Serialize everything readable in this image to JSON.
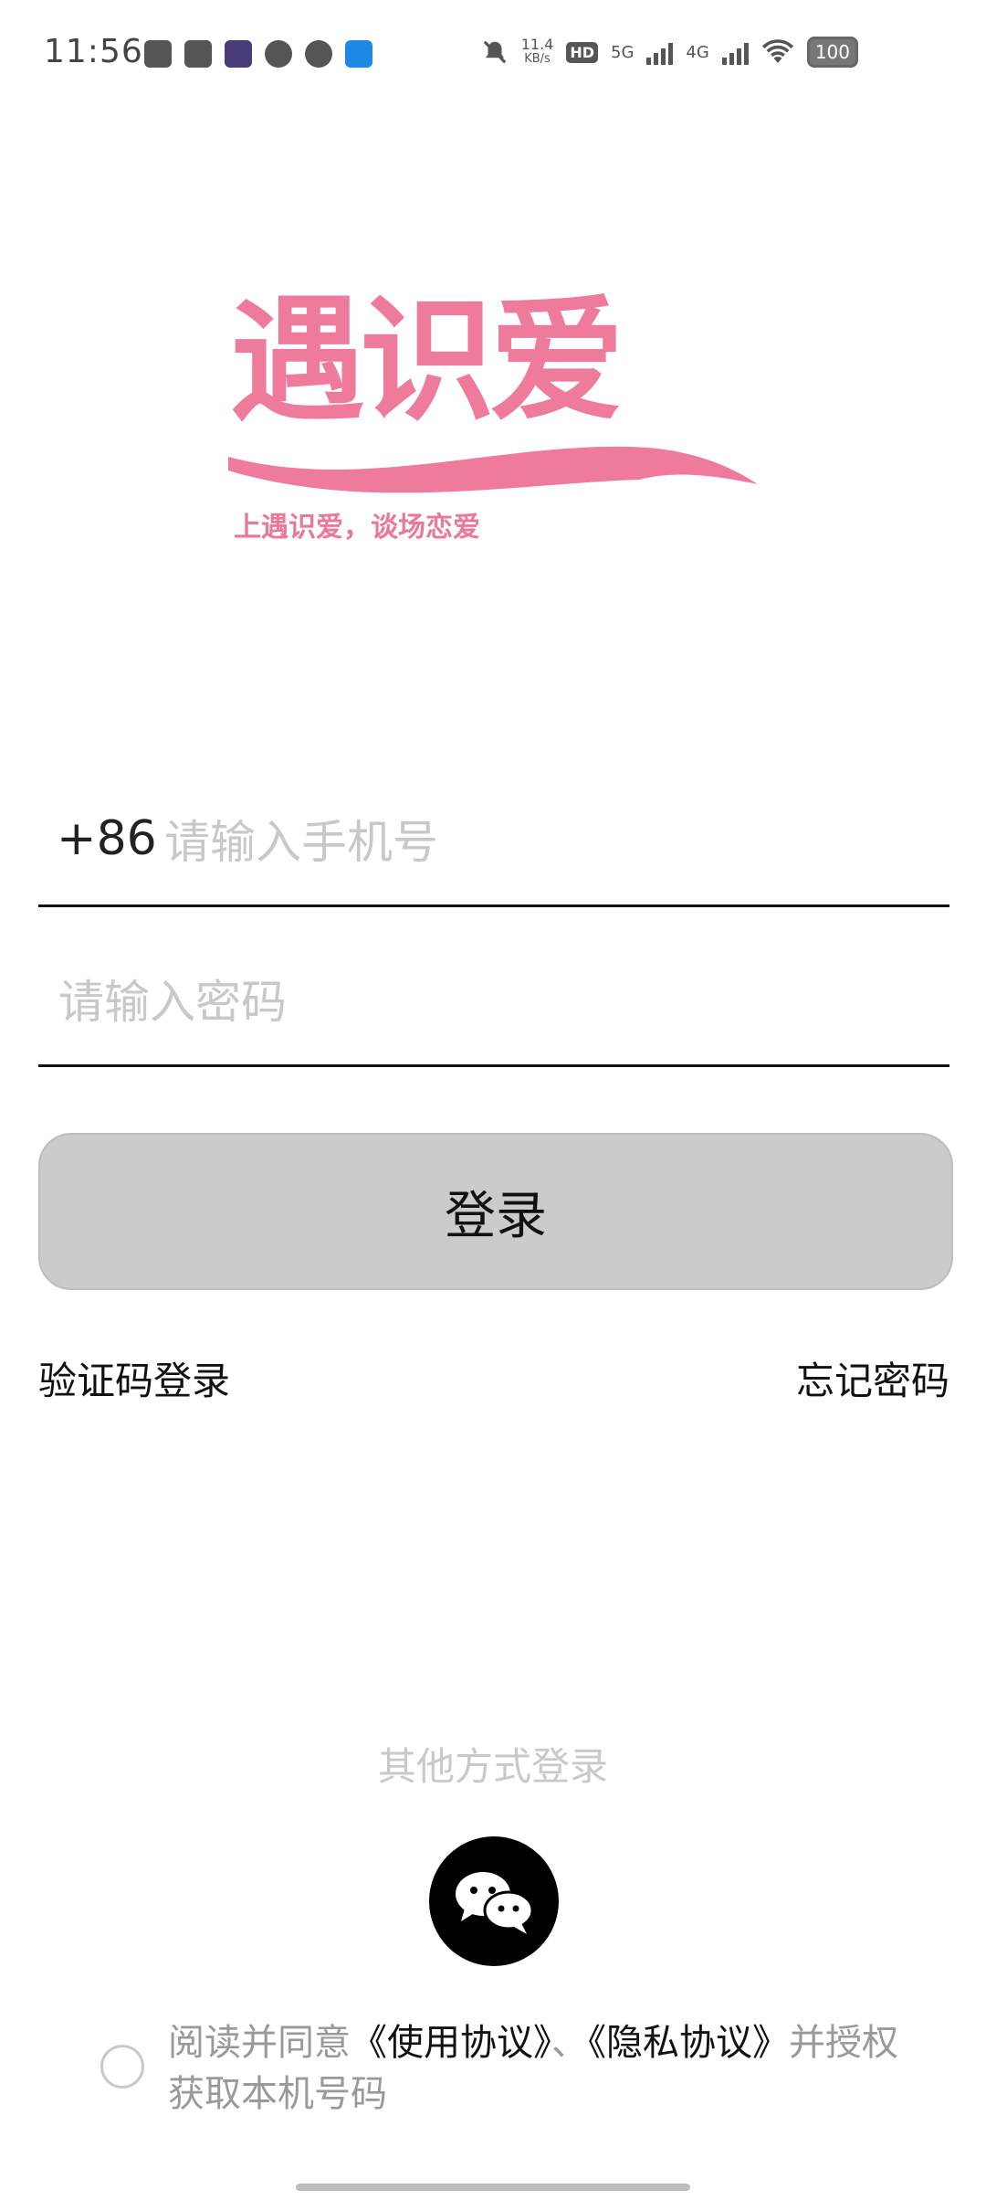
{
  "status_bar": {
    "time": "11:56",
    "net_speed_value": "11.4",
    "net_speed_unit": "KB/s",
    "hd_label": "HD",
    "sim1_label": "5G",
    "sim2_label": "4G",
    "battery": "100"
  },
  "logo": {
    "title": "遇识爱",
    "slogan": "上遇识爱，谈场恋爱",
    "color": "#ef7b9c"
  },
  "login_form": {
    "country_code": "+86",
    "phone_placeholder": "请输入手机号",
    "password_placeholder": "请输入密码",
    "submit_label": "登录"
  },
  "links": {
    "sms_login": "验证码登录",
    "forgot_password": "忘记密码"
  },
  "other_login": {
    "title": "其他方式登录",
    "wechat_icon": "wechat-icon"
  },
  "agreement": {
    "prefix": "阅读并同意",
    "terms": "《使用协议》",
    "separator": "、",
    "privacy": "《隐私协议》",
    "suffix": "并授权获取本机号码"
  }
}
